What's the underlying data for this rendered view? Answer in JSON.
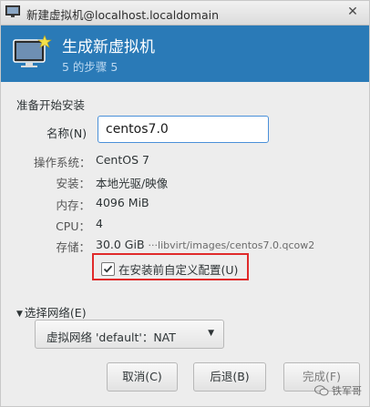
{
  "window": {
    "title": "新建虚拟机@localhost.localdomain",
    "close_glyph": "✕"
  },
  "header": {
    "title": "生成新虚拟机",
    "step": "5 的步骤 5"
  },
  "section": {
    "label": "准备开始安装"
  },
  "name_field": {
    "label": "名称(N)",
    "value": "centos7.0"
  },
  "summary": {
    "os_label": "操作系统：",
    "os_value": "CentOS 7",
    "install_label": "安装：",
    "install_value": "本地光驱/映像",
    "memory_label": "内存：",
    "memory_value": "4096 MiB",
    "cpu_label": "CPU：",
    "cpu_value": "4",
    "storage_label": "存储：",
    "storage_value": "30.0 GiB",
    "storage_path": "···libvirt/images/centos7.0.qcow2"
  },
  "customize": {
    "label": "在安装前自定义配置(U)",
    "checked": true
  },
  "network": {
    "expander_label": "选择网络(E)",
    "selected": "虚拟网络 'default'：NAT"
  },
  "buttons": {
    "cancel": "取消(C)",
    "back": "后退(B)",
    "finish": "完成(F)"
  },
  "watermark": {
    "text": "铁军哥"
  },
  "colors": {
    "banner": "#2a7ab7",
    "highlight": "#e02a2a",
    "focus": "#4a90d9"
  }
}
